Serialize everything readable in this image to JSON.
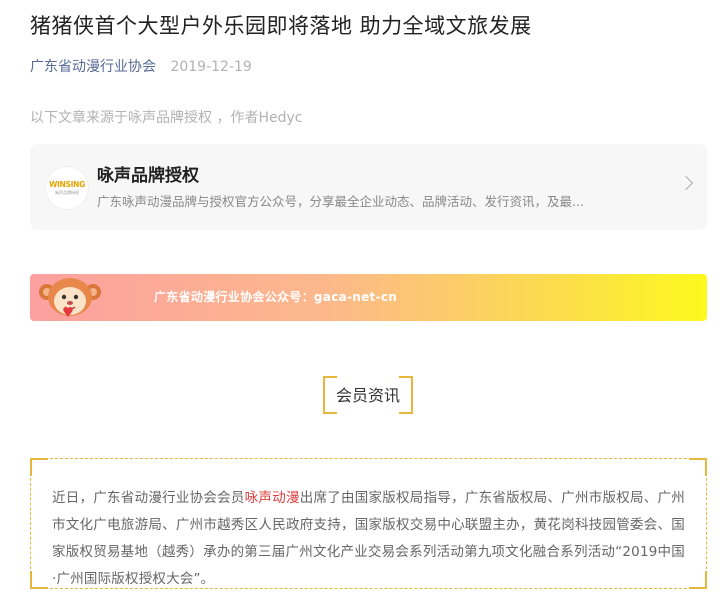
{
  "article": {
    "title": "猪猪侠首个大型户外乐园即将落地 助力全域文旅发展",
    "author": "广东省动漫行业协会",
    "date": "2019-12-19",
    "source_note": "以下文章来源于咏声品牌授权 ，作者Hedyc"
  },
  "account_card": {
    "logo_text": "WINSING",
    "logo_sub": "咏声品牌授权",
    "name": "咏声品牌授权",
    "description": "广东咏声动漫品牌与授权官方公众号，分享最全企业动态、品牌活动、发行资讯，及最..."
  },
  "banner": {
    "text": "广东省动漫行业协会公众号：gaca-net-cn"
  },
  "section": {
    "label": "会员资讯"
  },
  "paragraph": {
    "before": "近日，广东省动漫行业协会会员",
    "highlight": "咏声动漫",
    "after": "出席了由国家版权局指导，广东省版权局、广州市版权局、广州市文化广电旅游局、广州市越秀区人民政府支持，国家版权交易中心联盟主办，黄花岗科技园管委会、国家版权贸易基地（越秀）承办的第三届广州文化产业交易会系列活动第九项文化融合系列活动“2019中国·广州国际版权授权大会”。"
  },
  "colors": {
    "accent_gold": "#e6b73a",
    "highlight_red": "#e03e3e",
    "link_blue": "#576b95"
  }
}
